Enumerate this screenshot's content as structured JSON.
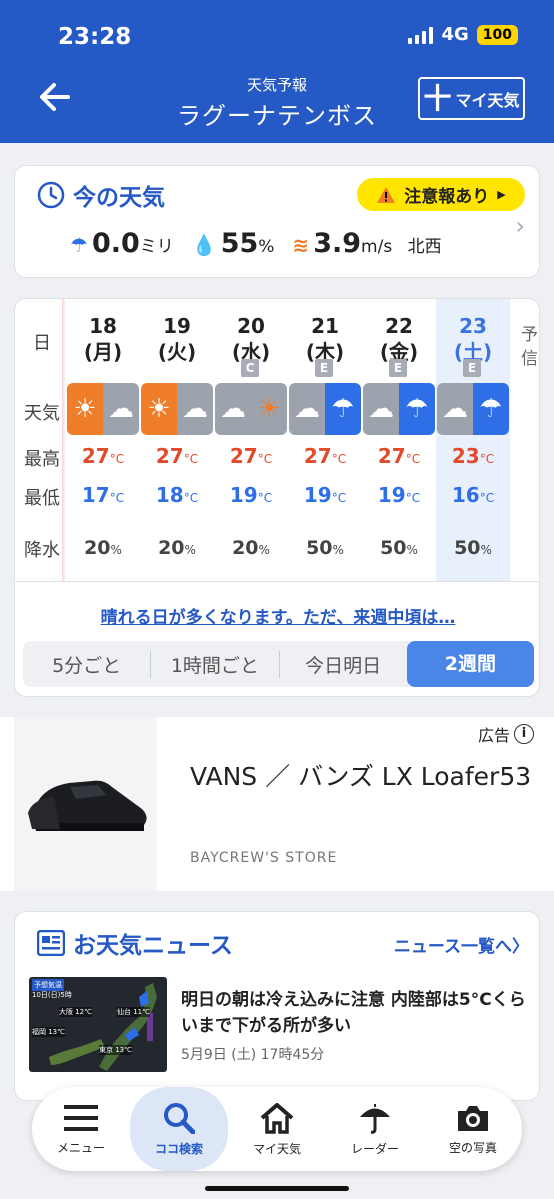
{
  "status": {
    "time": "23:28",
    "network": "4G",
    "battery": "100"
  },
  "header": {
    "subtitle": "天気予報",
    "title": "ラグーナテンボス",
    "my_button": "マイ天気",
    "plus": "十"
  },
  "now": {
    "title": "今の天気",
    "alert": "注意報あり",
    "precip": "0.0",
    "precip_unit": "ミリ",
    "humidity": "55",
    "humidity_unit": "%",
    "wind": "3.9",
    "wind_unit": "m/s",
    "wind_dir": "北西"
  },
  "forecast": {
    "labels": {
      "day": "日",
      "weather": "天気",
      "high": "最高",
      "low": "最低",
      "rain": "降水"
    },
    "more": "予信",
    "days": [
      {
        "date": "18",
        "dow": "(月)",
        "rank": "",
        "icon": "sun-cloud",
        "high": "27",
        "low": "17",
        "rain": "20"
      },
      {
        "date": "19",
        "dow": "(火)",
        "rank": "",
        "icon": "sun-cloud",
        "high": "27",
        "low": "18",
        "rain": "20"
      },
      {
        "date": "20",
        "dow": "(水)",
        "rank": "C",
        "icon": "cloud-sun",
        "high": "27",
        "low": "19",
        "rain": "20"
      },
      {
        "date": "21",
        "dow": "(木)",
        "rank": "E",
        "icon": "cloud-rain",
        "high": "27",
        "low": "19",
        "rain": "50"
      },
      {
        "date": "22",
        "dow": "(金)",
        "rank": "E",
        "icon": "cloud-rain",
        "high": "27",
        "low": "19",
        "rain": "50"
      },
      {
        "date": "23",
        "dow": "(土)",
        "rank": "E",
        "icon": "cloud-rain",
        "high": "23",
        "low": "16",
        "rain": "50"
      }
    ],
    "temp_unit": "°C",
    "rain_unit": "%",
    "message": "晴れる日が多くなります。ただ、来週中頃は…",
    "tabs": [
      "5分ごと",
      "1時間ごと",
      "今日明日",
      "2週間"
    ]
  },
  "ad": {
    "label": "広告",
    "info": "i",
    "title": "VANS ／ バンズ LX Loafer53",
    "store": "BAYCREW'S STORE"
  },
  "news": {
    "title": "お天気ニュース",
    "all_link": "ニュース一覧へ",
    "img_caption": "予想気温",
    "img_sub": "10日(日)5時",
    "map_labels": [
      "大阪 12℃",
      "仙台 11℃",
      "福岡 13℃",
      "東京 13℃"
    ],
    "headline": "明日の朝は冷え込みに注意 内陸部は5°Cくらいまで下がる所が多い",
    "date": "5月9日 (土) 17時45分"
  },
  "nav": {
    "items": [
      {
        "label": "メニュー",
        "icon": "menu-icon"
      },
      {
        "label": "ココ検索",
        "icon": "search-icon"
      },
      {
        "label": "マイ天気",
        "icon": "home-icon"
      },
      {
        "label": "レーダー",
        "icon": "umbrella-icon"
      },
      {
        "label": "空の写真",
        "icon": "camera-icon"
      }
    ]
  },
  "colors": {
    "brand": "#2559c6",
    "alert": "#ffe500",
    "high": "#e24a2c",
    "low": "#2e6ee6",
    "sun": "#ef7d2a"
  }
}
